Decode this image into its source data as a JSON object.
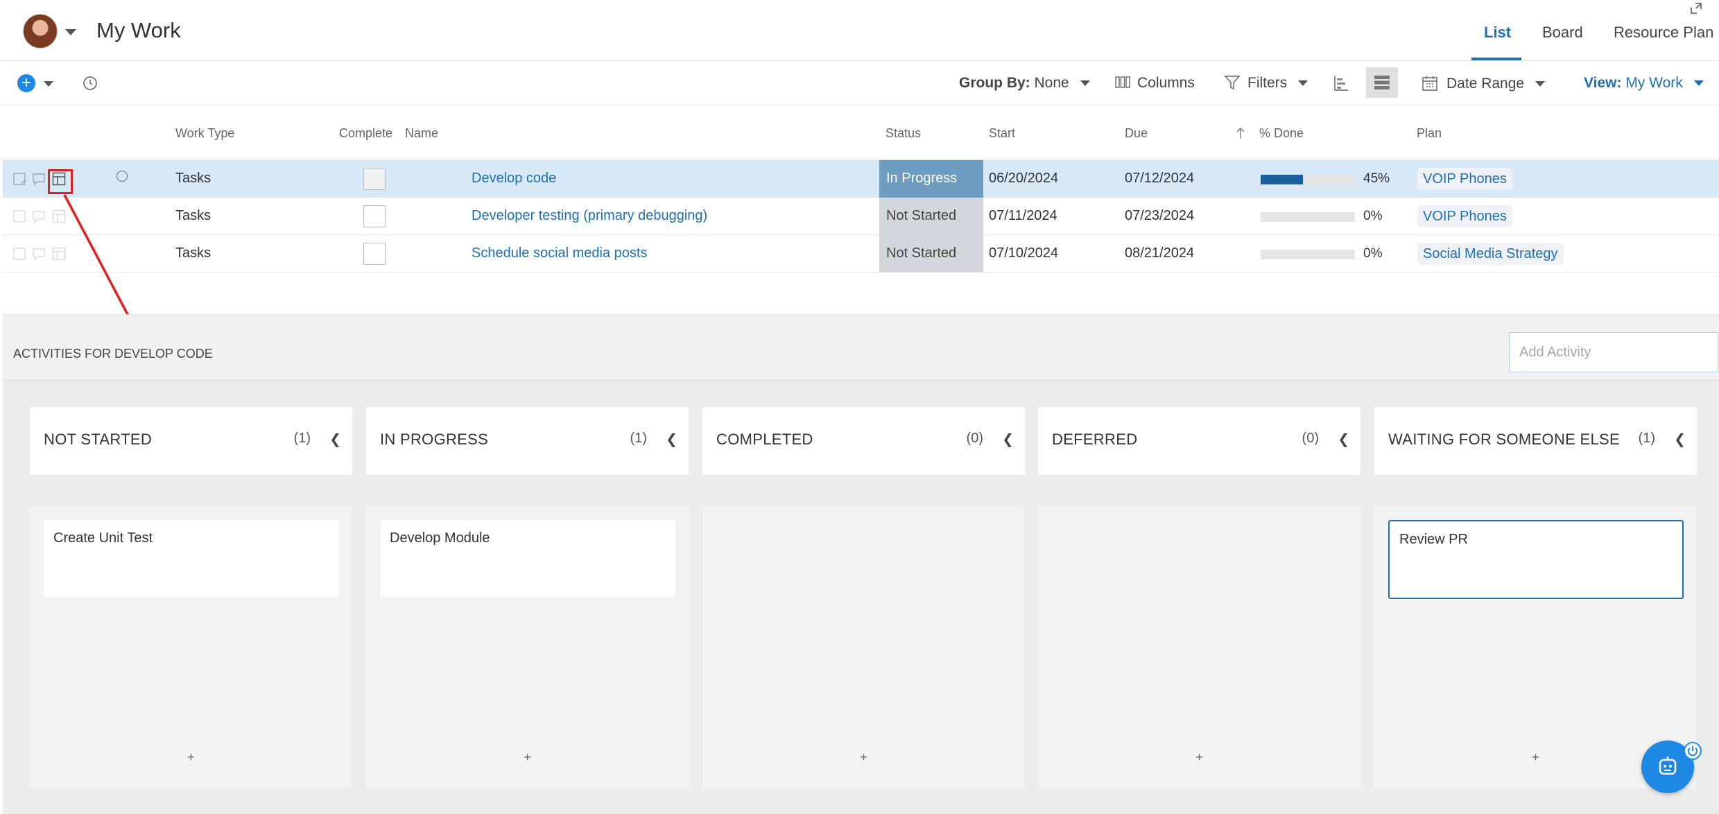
{
  "header": {
    "title": "My Work",
    "nav": [
      "List",
      "Board",
      "Resource Plan"
    ]
  },
  "toolbar": {
    "group_by_label": "Group By:",
    "group_by_value": "None",
    "columns_label": "Columns",
    "filters_label": "Filters",
    "date_range_label": "Date Range",
    "view_label": "View:",
    "view_value": "My Work"
  },
  "grid": {
    "headers": {
      "work_type": "Work Type",
      "complete": "Complete",
      "name": "Name",
      "status": "Status",
      "start": "Start",
      "due": "Due",
      "percent_done": "% Done",
      "plan": "Plan"
    },
    "rows": [
      {
        "work_type": "Tasks",
        "name": "Develop code",
        "status": "In Progress",
        "start": "06/20/2024",
        "due": "07/12/2024",
        "percent": 45,
        "percent_label": "45%",
        "plan": "VOIP Phones"
      },
      {
        "work_type": "Tasks",
        "name": "Developer testing (primary debugging)",
        "status": "Not Started",
        "start": "07/11/2024",
        "due": "07/23/2024",
        "percent": 0,
        "percent_label": "0%",
        "plan": "VOIP Phones"
      },
      {
        "work_type": "Tasks",
        "name": "Schedule social media posts",
        "status": "Not Started",
        "start": "07/10/2024",
        "due": "08/21/2024",
        "percent": 0,
        "percent_label": "0%",
        "plan": "Social Media Strategy"
      }
    ]
  },
  "activities": {
    "title": "ACTIVITIES FOR DEVELOP CODE",
    "add_placeholder": "Add Activity",
    "add_label": "+",
    "columns": [
      {
        "name": "NOT STARTED",
        "count": "(1)",
        "cards": [
          "Create Unit Test"
        ]
      },
      {
        "name": "IN PROGRESS",
        "count": "(1)",
        "cards": [
          "Develop Module"
        ]
      },
      {
        "name": "COMPLETED",
        "count": "(0)",
        "cards": []
      },
      {
        "name": "DEFERRED",
        "count": "(0)",
        "cards": []
      },
      {
        "name": "WAITING FOR SOMEONE ELSE",
        "count": "(1)",
        "cards": [
          "Review PR"
        ]
      }
    ]
  },
  "colors": {
    "accent": "#1f6fb3",
    "in_progress": "#6d9ec2",
    "not_started": "#d3d6dc",
    "highlight": "#e02020"
  }
}
